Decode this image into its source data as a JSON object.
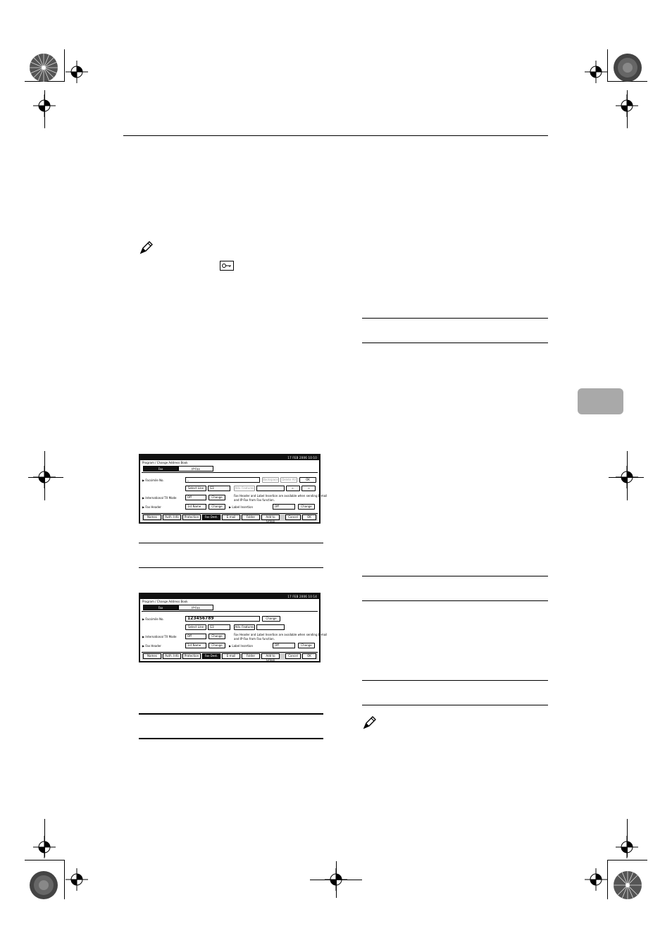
{
  "screen1": {
    "date": "17 FEB   2006 10:10",
    "title": "Program / Change Address Book",
    "tabs": [
      "Fax",
      "IP-Fax"
    ],
    "facsimile_label": "Facsimile No.",
    "facsimile_value": "_",
    "backspace": "Backspace",
    "delete_all": "Delete All",
    "ok_small": "OK",
    "select_line": "Select Line",
    "g3": "G3",
    "adv_features": "Adv. Features",
    "left_arrow": "←",
    "right_arrow": "→",
    "intl_tx_label": "International TX Mode",
    "intl_tx_value": "Off",
    "change1": "Change",
    "info_text_1": "Fax Header and Label Insertion are available when sending E-mail",
    "info_text_2": "and IP-Fax from Fax function.",
    "fax_header_label": "Fax Header",
    "fax_header_value": "1st Name",
    "change2": "Change",
    "label_insertion_label": "Label Insertion",
    "label_insertion_value": "Off",
    "change3": "Change",
    "bottom_tabs": [
      "Names",
      "Auth. Info",
      "Protection",
      "Fax Dest.",
      "E-mail",
      "Folder",
      "Add to Group"
    ],
    "cancel": "Cancel",
    "ok": "OK"
  },
  "screen2": {
    "date": "17 FEB   2006 10:14",
    "title": "Program / Change Address Book",
    "tabs": [
      "Fax",
      "IP-Fax"
    ],
    "facsimile_label": "Facsimile No.",
    "facsimile_value": "123456789",
    "change0": "Change",
    "select_line": "Select Line",
    "g3": "G3",
    "adv_features": "Adv. Features",
    "intl_tx_label": "International TX Mode",
    "intl_tx_value": "Off",
    "change1": "Change",
    "info_text_1": "Fax Header and Label Insertion are available when sending E-mail",
    "info_text_2": "and IP-Fax from Fax function.",
    "fax_header_label": "Fax Header",
    "fax_header_value": "1st Name",
    "change2": "Change",
    "label_insertion_label": "Label Insertion",
    "label_insertion_value": "Off",
    "change3": "Change",
    "bottom_tabs": [
      "Names",
      "Auth. Info",
      "Protection",
      "Fax Dest.",
      "E-mail",
      "Folder",
      "Add to Group"
    ],
    "cancel": "Cancel",
    "ok": "OK"
  },
  "icons": [
    "note-icon",
    "key-icon",
    "registration-mark-icon",
    "color-wheel-icon"
  ],
  "colors": {
    "tab_marker": "#a9a9a9",
    "screen_bar": "#111111"
  }
}
